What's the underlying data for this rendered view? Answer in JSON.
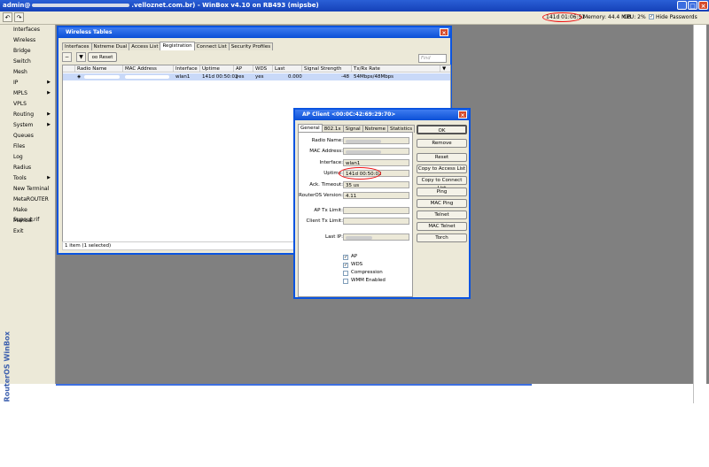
{
  "app": {
    "title": "admin@ .velloznet.com.br) - WinBox v4.10 on RB493 (mipsbe)",
    "title_prefix": "admin@",
    "title_suffix": ".velloznet.com.br) - WinBox v4.10 on RB493 (mipsbe)",
    "brand": "RouterOS WinBox"
  },
  "toolbar": {
    "undo_icon": "undo-icon",
    "redo_icon": "redo-icon",
    "uptime": "141d 01:06:51",
    "memory": "Memory: 44.4 MiB",
    "cpu": "CPU: 2%",
    "hide_passwords": "Hide Passwords",
    "hide_passwords_checked": true
  },
  "sidebar": {
    "items": [
      {
        "label": "Interfaces",
        "submenu": false
      },
      {
        "label": "Wireless",
        "submenu": false
      },
      {
        "label": "Bridge",
        "submenu": false
      },
      {
        "label": "Switch",
        "submenu": false
      },
      {
        "label": "Mesh",
        "submenu": false
      },
      {
        "label": "IP",
        "submenu": true
      },
      {
        "label": "MPLS",
        "submenu": true
      },
      {
        "label": "VPLS",
        "submenu": false
      },
      {
        "label": "Routing",
        "submenu": true
      },
      {
        "label": "System",
        "submenu": true
      },
      {
        "label": "Queues",
        "submenu": false
      },
      {
        "label": "Files",
        "submenu": false
      },
      {
        "label": "Log",
        "submenu": false
      },
      {
        "label": "Radius",
        "submenu": false
      },
      {
        "label": "Tools",
        "submenu": true
      },
      {
        "label": "New Terminal",
        "submenu": false
      },
      {
        "label": "MetaROUTER",
        "submenu": false
      },
      {
        "label": "Make Supout.rif",
        "submenu": false
      },
      {
        "label": "Manual",
        "submenu": false
      },
      {
        "label": "Exit",
        "submenu": false
      }
    ]
  },
  "wireless_tables": {
    "title": "Wireless Tables",
    "tabs": [
      "Interfaces",
      "Nstreme Dual",
      "Access List",
      "Registration",
      "Connect List",
      "Security Profiles"
    ],
    "active_tab": "Registration",
    "reset_label": "Reset",
    "find_placeholder": "Find",
    "columns": [
      "Radio Name",
      "MAC Address",
      "Interface",
      "Uptime",
      "AP",
      "WDS",
      "Last Activit...",
      "Signal Strength (dBm)",
      "Tx/Rx Rate"
    ],
    "rows": [
      {
        "radio_name": "",
        "mac": "",
        "interface": "wlan1",
        "uptime": "141d 00:50:02",
        "ap": "yes",
        "wds": "yes",
        "last_activity": "0.000",
        "signal": "-48",
        "rate": "54Mbps/48Mbps"
      }
    ],
    "footer": "1 item (1 selected)"
  },
  "ap_client": {
    "title": "AP Client <00:0C:42:69:29:70>",
    "tabs": [
      "General",
      "802.1x",
      "Signal",
      "Nstreme",
      "Statistics"
    ],
    "active_tab": "General",
    "fields": {
      "radio_name_label": "Radio Name:",
      "radio_name": "",
      "mac_label": "MAC Address:",
      "mac": "",
      "interface_label": "Interface:",
      "interface": "wlan1",
      "uptime_label": "Uptime:",
      "uptime": "141d 00:50:02",
      "ack_label": "Ack. Timeout:",
      "ack": "35 us",
      "ros_label": "RouterOS Version:",
      "ros": "4.11",
      "ap_tx_label": "AP Tx Limit:",
      "ap_tx": "",
      "client_tx_label": "Client Tx Limit:",
      "client_tx": "",
      "last_ip_label": "Last IP:",
      "last_ip": ""
    },
    "checks": [
      {
        "label": "AP",
        "checked": true
      },
      {
        "label": "WDS",
        "checked": true
      },
      {
        "label": "Compression",
        "checked": false
      },
      {
        "label": "WMM Enabled",
        "checked": false
      }
    ],
    "buttons": [
      "OK",
      "Remove",
      "Reset",
      "Copy to Access List",
      "Copy to Connect List",
      "Ping",
      "MAC Ping",
      "Telnet",
      "MAC Telnet",
      "Torch"
    ]
  },
  "colors": {
    "titlebar": "#1541b8",
    "window_border": "#0a54e0",
    "highlight_oval": "#e11111",
    "selected_row": "#c9d9f8",
    "desktop": "#808080"
  }
}
